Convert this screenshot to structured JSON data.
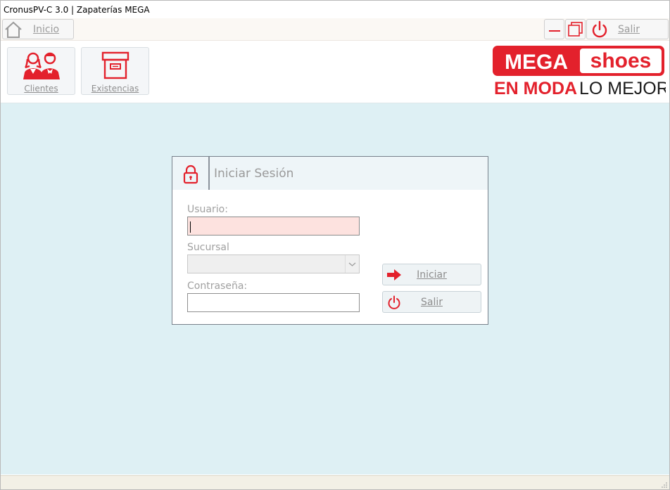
{
  "window": {
    "title": "CronusPV-C 3.0 | Zapaterías MEGA"
  },
  "toolbar": {
    "home_label": "Inicio",
    "home_icon": "home-icon",
    "minimize_icon": "minimize-icon",
    "restore_icon": "restore-icon",
    "exit_label": "Salir",
    "exit_icon": "power-icon"
  },
  "modules": [
    {
      "label": "Clientes",
      "icon": "customers-icon"
    },
    {
      "label": "Existencias",
      "icon": "archive-box-icon"
    }
  ],
  "logo": {
    "word1": "MEGA",
    "word2": "shoes",
    "tagline_bold": "EN MODA",
    "tagline_light": "LO MEJOR"
  },
  "login": {
    "title": "Iniciar Sesión",
    "lock_icon": "lock-icon",
    "user_label": "Usuario:",
    "user_value": "",
    "branch_label": "Sucursal",
    "branch_value": "",
    "password_label": "Contraseña:",
    "password_value": "",
    "login_button": "Iniciar",
    "login_icon": "arrow-right-icon",
    "exit_button": "Salir",
    "exit_icon": "power-icon"
  },
  "colors": {
    "brand_red": "#e3212c",
    "workspace_bg": "#def0f4",
    "user_field_bg": "#fde2df"
  }
}
